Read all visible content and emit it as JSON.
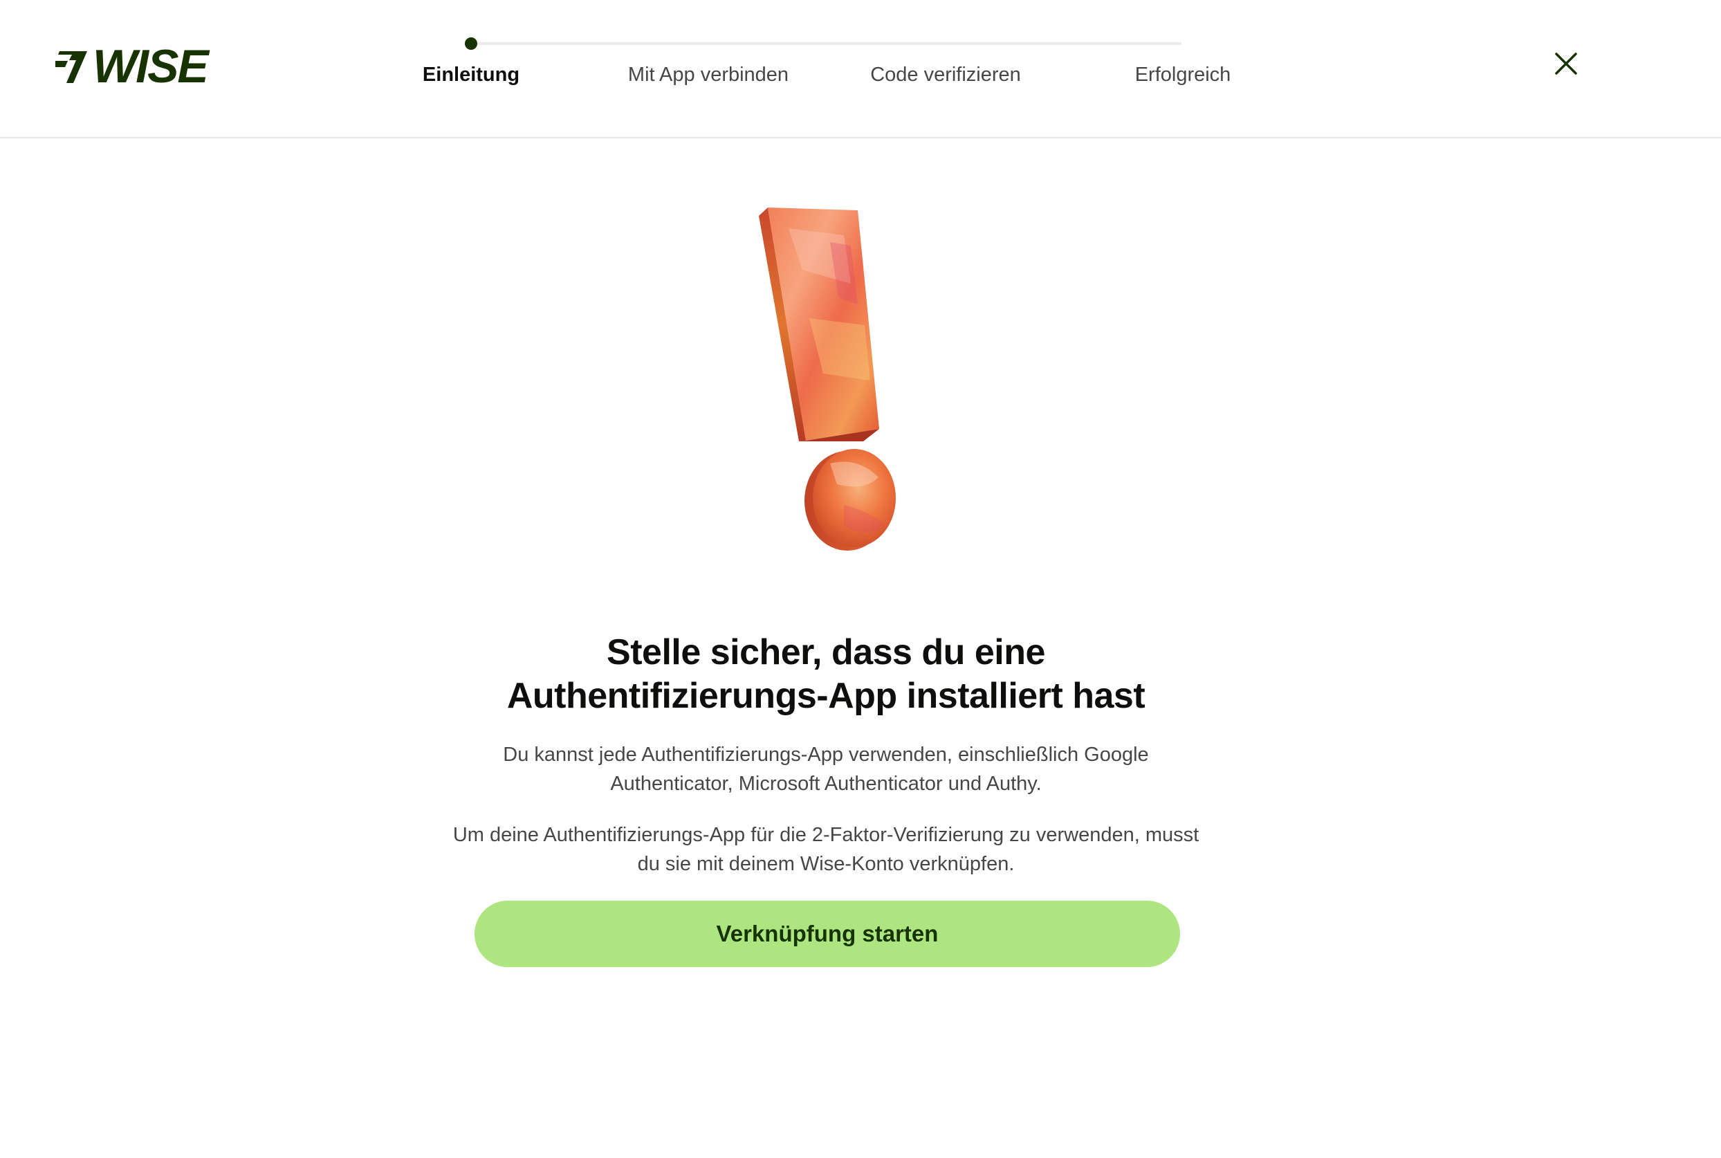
{
  "header": {
    "logo_text": "WISE",
    "logo_icon": "wise-flag-icon",
    "close_icon": "close-icon"
  },
  "stepper": {
    "current_step": 1,
    "steps": [
      {
        "label": "Einleitung",
        "active": true
      },
      {
        "label": "Mit App verbinden",
        "active": false
      },
      {
        "label": "Code verifizieren",
        "active": false
      },
      {
        "label": "Erfolgreich",
        "active": false
      }
    ]
  },
  "main": {
    "illustration_icon": "exclamation-mark-icon",
    "title_line1": "Stelle sicher, dass du eine",
    "title_line2": "Authentifizierungs-App installiert hast",
    "paragraph1": "Du kannst jede Authentifizierungs-App verwenden, einschließlich Google Authenticator, Microsoft Authenticator und Authy.",
    "paragraph2": "Um deine Authentifizierungs-App für die 2-Faktor-Verifizierung zu verwenden, musst du sie mit deinem Wise-Konto verknüpfen.",
    "cta_label": "Verknüpfung starten"
  },
  "colors": {
    "brand_dark_green": "#163300",
    "brand_bright_green": "#ade681",
    "text_primary": "#0e0f0c",
    "text_secondary": "#454745",
    "divider": "#e6e6e6"
  }
}
